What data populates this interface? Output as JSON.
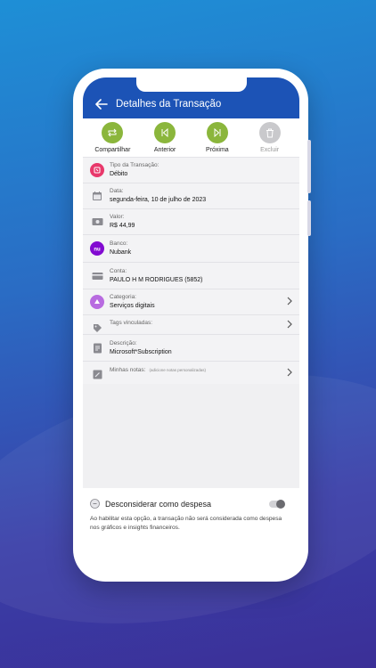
{
  "header": {
    "title": "Detalhes da Transação"
  },
  "actions": [
    {
      "label": "Compartilhar",
      "icon": "share-icon",
      "color": "#8bb63c"
    },
    {
      "label": "Anterior",
      "icon": "previous-icon",
      "color": "#8bb63c"
    },
    {
      "label": "Próxima",
      "icon": "next-icon",
      "color": "#8bb63c"
    },
    {
      "label": "Excluir",
      "icon": "trash-icon",
      "color": "#c9c9cc"
    }
  ],
  "rows": [
    {
      "key": "Tipo da Transação:",
      "value": "Débito",
      "icon": "debit-icon"
    },
    {
      "key": "Data:",
      "value": "segunda-feira, 10 de julho de 2023",
      "icon": "calendar-icon"
    },
    {
      "key": "Valor:",
      "value": "R$ 44,99",
      "icon": "money-icon"
    },
    {
      "key": "Banco:",
      "value": "Nubank",
      "icon": "nubank-icon"
    },
    {
      "key": "Conta:",
      "value": "PAULO H M RODRIGUES (5852)",
      "icon": "card-icon"
    },
    {
      "key": "Categoria:",
      "value": "Serviços digitais",
      "icon": "category-icon"
    },
    {
      "key": "Tags vinculadas:",
      "value": "",
      "icon": "tag-icon"
    },
    {
      "key": "Descrição:",
      "value": "Microsoft*Subscription",
      "icon": "description-icon"
    },
    {
      "key": "Minhas notas:",
      "value": "",
      "hint": "(adicione notas personalizadas)",
      "icon": "notes-icon"
    }
  ],
  "ignore": {
    "title": "Desconsiderar como despesa",
    "description": "Ao habilitar esta opção, a transação não será considerada como despesa nos gráficos e insights financeiros."
  },
  "colors": {
    "primary": "#1c53b6",
    "accent": "#8bb63c",
    "debit": "#e8386b",
    "nubank": "#820ad1",
    "category": "#b86be0"
  }
}
